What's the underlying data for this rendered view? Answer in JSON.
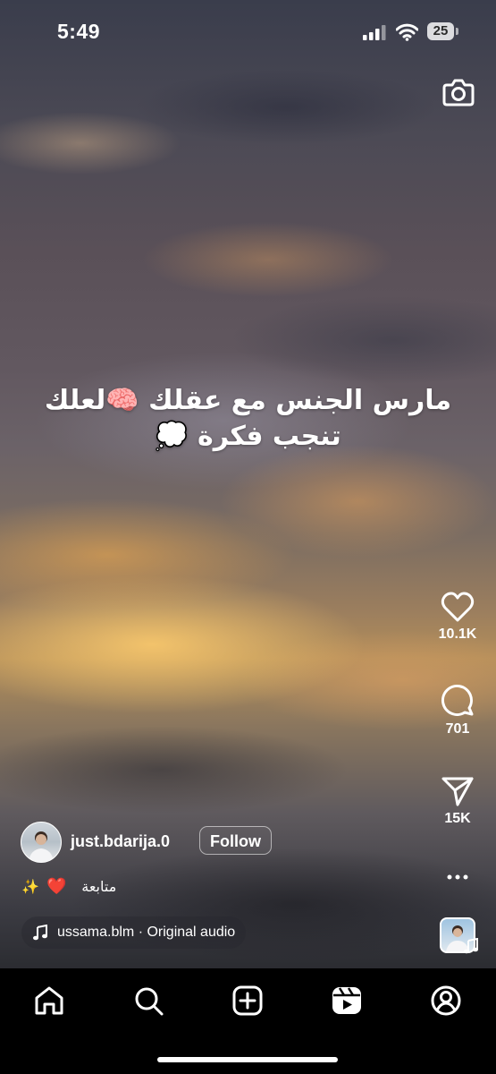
{
  "status_bar": {
    "time": "5:49",
    "battery_level": "25"
  },
  "reel": {
    "caption_lines": [
      "مارس الجنس مع عقلك 🧠لعلك",
      "تنجب فكرة 💭"
    ]
  },
  "actions": {
    "like_count": "10.1K",
    "comment_count": "701",
    "share_count": "15K"
  },
  "author": {
    "username": "just.bdarija.0",
    "follow_label": "Follow"
  },
  "description": {
    "emojis_sparkle": "✨",
    "emoji_heart": "❤️",
    "text": "متابعة"
  },
  "audio": {
    "label": "ussama.blm · Original audio"
  },
  "nav": {
    "items": [
      "home-icon",
      "search-icon",
      "create-icon",
      "reels-icon",
      "profile-icon"
    ]
  },
  "colors": {
    "background": "#000000",
    "text": "#ffffff",
    "heart_emoji": "#e0252d"
  }
}
